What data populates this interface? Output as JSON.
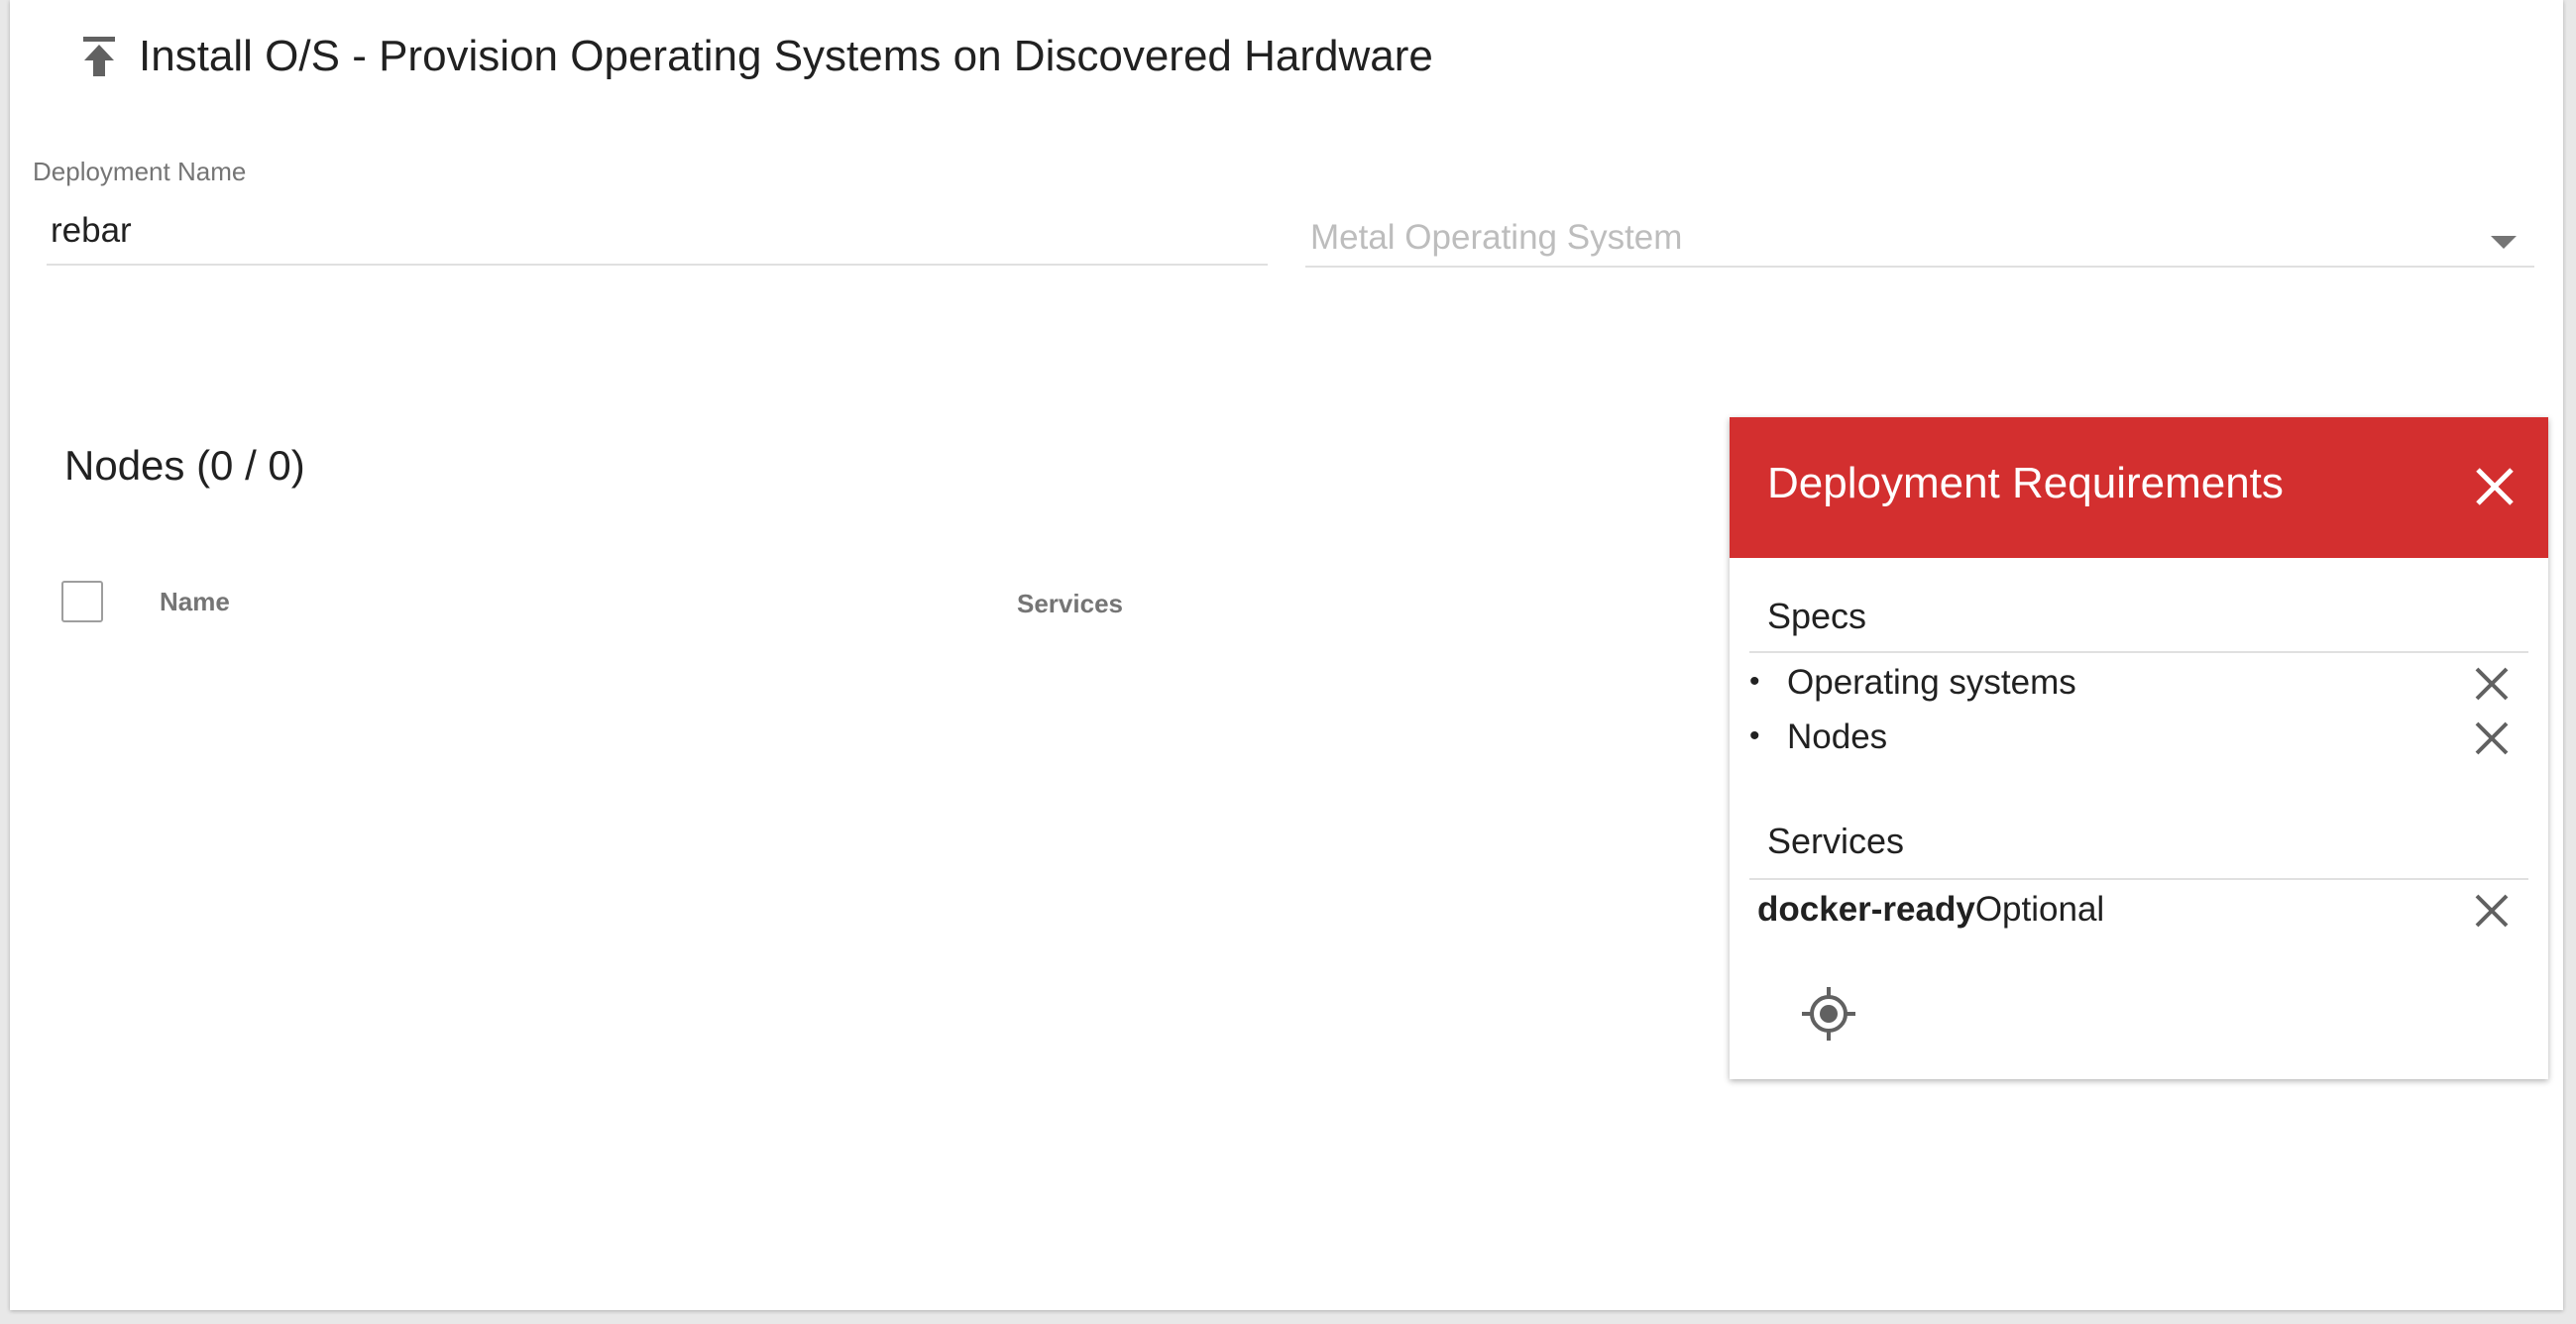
{
  "header": {
    "title": "Install O/S - Provision Operating Systems on Discovered Hardware",
    "icon": "upload-arrow-icon"
  },
  "form": {
    "deployment_name_label": "Deployment Name",
    "deployment_name_value": "rebar",
    "os_select_placeholder": "Metal Operating System"
  },
  "nodes": {
    "title": "Nodes (0 / 0)",
    "columns": [
      "Name",
      "Services"
    ]
  },
  "requirements": {
    "title": "Deployment Requirements",
    "accent_color": "#d32f2f",
    "specs_title": "Specs",
    "specs": [
      "Operating systems",
      "Nodes"
    ],
    "services_title": "Services",
    "services": [
      {
        "name": "docker-ready",
        "status": "Optional"
      }
    ]
  }
}
